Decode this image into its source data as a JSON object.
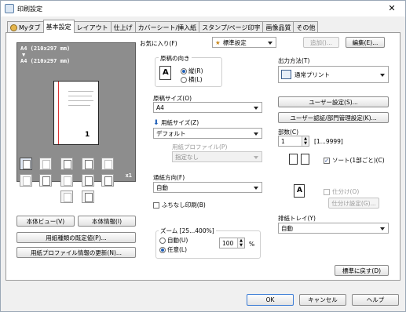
{
  "window": {
    "title": "印刷設定",
    "close": "✕"
  },
  "tabs": [
    "Myタブ",
    "基本設定",
    "レイアウト",
    "仕上げ",
    "カバーシート/挿入紙",
    "スタンプ/ページ印字",
    "画像品質",
    "その他"
  ],
  "preview": {
    "line1": "A4 (210x297 mm)",
    "arrow": "▼",
    "line2": "A4 (210x297 mm)",
    "copies": "x1",
    "page_number": "1"
  },
  "left_buttons": {
    "body_view": "本体ビュー(V)",
    "body_info": "本体情報(I)",
    "paper_type_default": "用紙種類の既定値(P)...",
    "paper_profile_update": "用紙プロファイル情報の更新(N)..."
  },
  "favorites": {
    "label": "お気に入り(F)",
    "value": "標準設定",
    "add": "追加()...",
    "edit": "編集(E)..."
  },
  "orientation": {
    "label": "原稿の向き",
    "portrait": "縦(R)",
    "landscape": "横(L)",
    "selected": "portrait"
  },
  "original_size": {
    "label": "原稿サイズ(O)",
    "value": "A4"
  },
  "paper_size": {
    "label": "用紙サイズ(Z)",
    "value": "デフォルト"
  },
  "paper_profile": {
    "label": "用紙プロファイル(P)",
    "value": "指定なし"
  },
  "paper_direction": {
    "label": "通紙方向(F)",
    "value": "自動"
  },
  "borderless": {
    "label": "ふちなし印刷(B)",
    "checked": false
  },
  "zoom": {
    "label": "ズーム [25...400%]",
    "auto": "自動(U)",
    "manual": "任意(L)",
    "selected": "manual",
    "value": "100",
    "unit": "%"
  },
  "output_method": {
    "label": "出力方法(T)",
    "value": "通常プリント",
    "user_settings": "ユーザー設定(S)...",
    "auth_settings": "ユーザー認証/部門管理設定(K)..."
  },
  "copies": {
    "label": "部数(C)",
    "value": "1",
    "range": "[1...9999]"
  },
  "collate": {
    "label": "ソート(1部ごと)(C)",
    "checked": true
  },
  "offset": {
    "label": "仕分け(O)",
    "checked": false,
    "settings": "仕分け設定(G)..."
  },
  "output_tray": {
    "label": "排紙トレイ(Y)",
    "value": "自動"
  },
  "reset": "標準に戻す(D)",
  "footer": {
    "ok": "OK",
    "cancel": "キャンセル",
    "help": "ヘルプ"
  }
}
